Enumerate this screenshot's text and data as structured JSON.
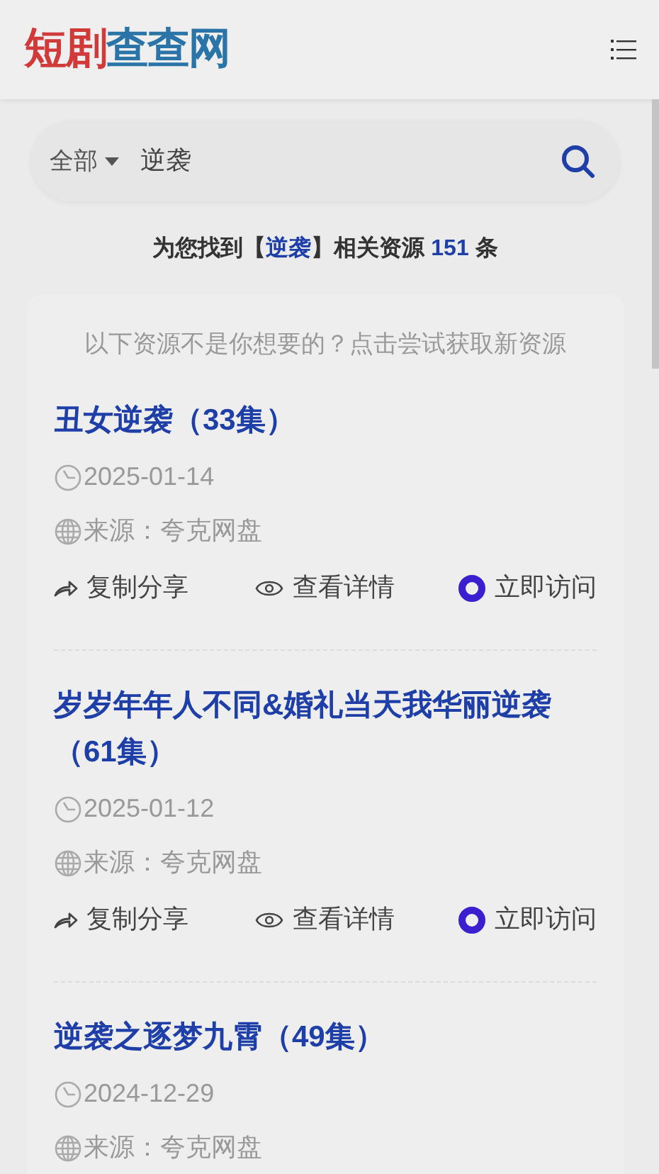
{
  "header": {
    "logo": [
      {
        "text": "短剧",
        "color": "#d23a3a"
      },
      {
        "text": "查查网",
        "color": "#2a74a8"
      }
    ]
  },
  "search": {
    "category": "全部",
    "value": "逆袭"
  },
  "summary": {
    "prefix": "为您找到【",
    "keyword": "逆袭",
    "middle": "】相关资源 ",
    "count": "151",
    "suffix": " 条"
  },
  "tip": "以下资源不是你想要的？点击尝试获取新资源",
  "results": [
    {
      "title": "丑女逆袭（33集）",
      "date": "2025-01-14",
      "source": "来源：夸克网盘",
      "actions": [
        "复制分享",
        "查看详情",
        "立即访问"
      ]
    },
    {
      "title": "岁岁年年人不同&婚礼当天我华丽逆袭（61集）",
      "date": "2025-01-12",
      "source": "来源：夸克网盘",
      "actions": [
        "复制分享",
        "查看详情",
        "立即访问"
      ]
    },
    {
      "title": "逆袭之逐梦九霄（49集）",
      "date": "2024-12-29",
      "source": "来源：夸克网盘"
    }
  ]
}
